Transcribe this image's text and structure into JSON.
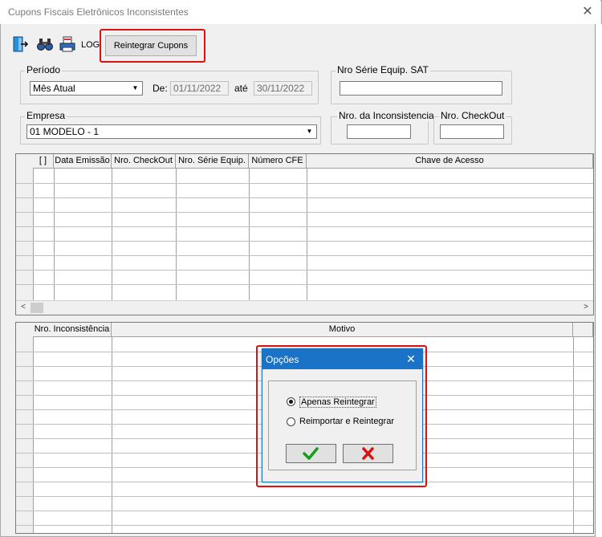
{
  "window": {
    "title": "Cupons Fiscais Eletrônicos Inconsistentes",
    "close_glyph": "✕"
  },
  "toolbar": {
    "log_label": "LOG",
    "reintegrar_label": "Reintegrar Cupons"
  },
  "periodo": {
    "label": "Período",
    "selected": "Mês Atual",
    "de_label": "De:",
    "de_value": "01/11/2022",
    "ate_label": "até",
    "ate_value": "30/11/2022"
  },
  "serie_sat": {
    "label": "Nro Série Equip. SAT",
    "value": ""
  },
  "empresa": {
    "label": "Empresa",
    "selected": "01 MODELO - 1"
  },
  "inconsistencia": {
    "label": "Nro. da Inconsistencia",
    "value": ""
  },
  "checkout": {
    "label": "Nro. CheckOut",
    "value": ""
  },
  "grid1": {
    "columns": [
      "[ ]",
      "Data Emissão",
      "Nro. CheckOut",
      "Nro. Série Equip.",
      "Número CFE",
      "Chave de Acesso"
    ]
  },
  "grid2": {
    "columns": [
      "Nro. Inconsistência",
      "Motivo"
    ]
  },
  "dialog": {
    "title": "Opções",
    "close_glyph": "✕",
    "options": [
      {
        "label": "Apenas Reintegrar",
        "selected": true
      },
      {
        "label": "Reimportar e Reintegrar",
        "selected": false
      }
    ],
    "ok_icon": "check-icon",
    "cancel_icon": "x-icon"
  },
  "colors": {
    "accent": "#1a73c7",
    "highlight": "#e01010",
    "ok": "#1a9a1a",
    "cancel": "#d81010"
  }
}
